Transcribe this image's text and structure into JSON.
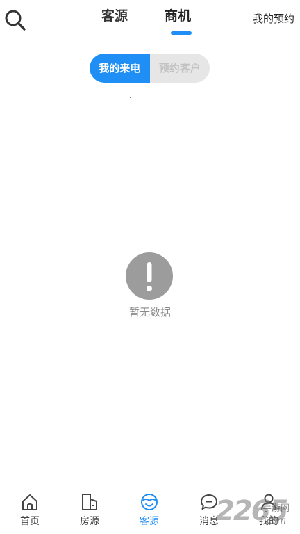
{
  "header": {
    "tabs": [
      {
        "label": "客源",
        "active": false
      },
      {
        "label": "商机",
        "active": true
      }
    ],
    "my_booking": "我的预约",
    "accent_color": "#1f8ef5"
  },
  "segment": {
    "items": [
      {
        "label": "我的来电",
        "active": true
      },
      {
        "label": "预约客户",
        "active": false
      }
    ]
  },
  "empty_state": {
    "icon": "exclamation-circle-icon",
    "text": "暂无数据"
  },
  "bottom_nav": {
    "items": [
      {
        "label": "首页",
        "icon": "home-icon",
        "active": false
      },
      {
        "label": "房源",
        "icon": "building-icon",
        "active": false
      },
      {
        "label": "客源",
        "icon": "customer-icon",
        "active": true
      },
      {
        "label": "消息",
        "icon": "message-icon",
        "active": false
      },
      {
        "label": "我的",
        "icon": "person-icon",
        "active": false
      }
    ]
  },
  "watermark": {
    "number": "2265",
    "text": "手游网",
    "suffix": ".com"
  }
}
